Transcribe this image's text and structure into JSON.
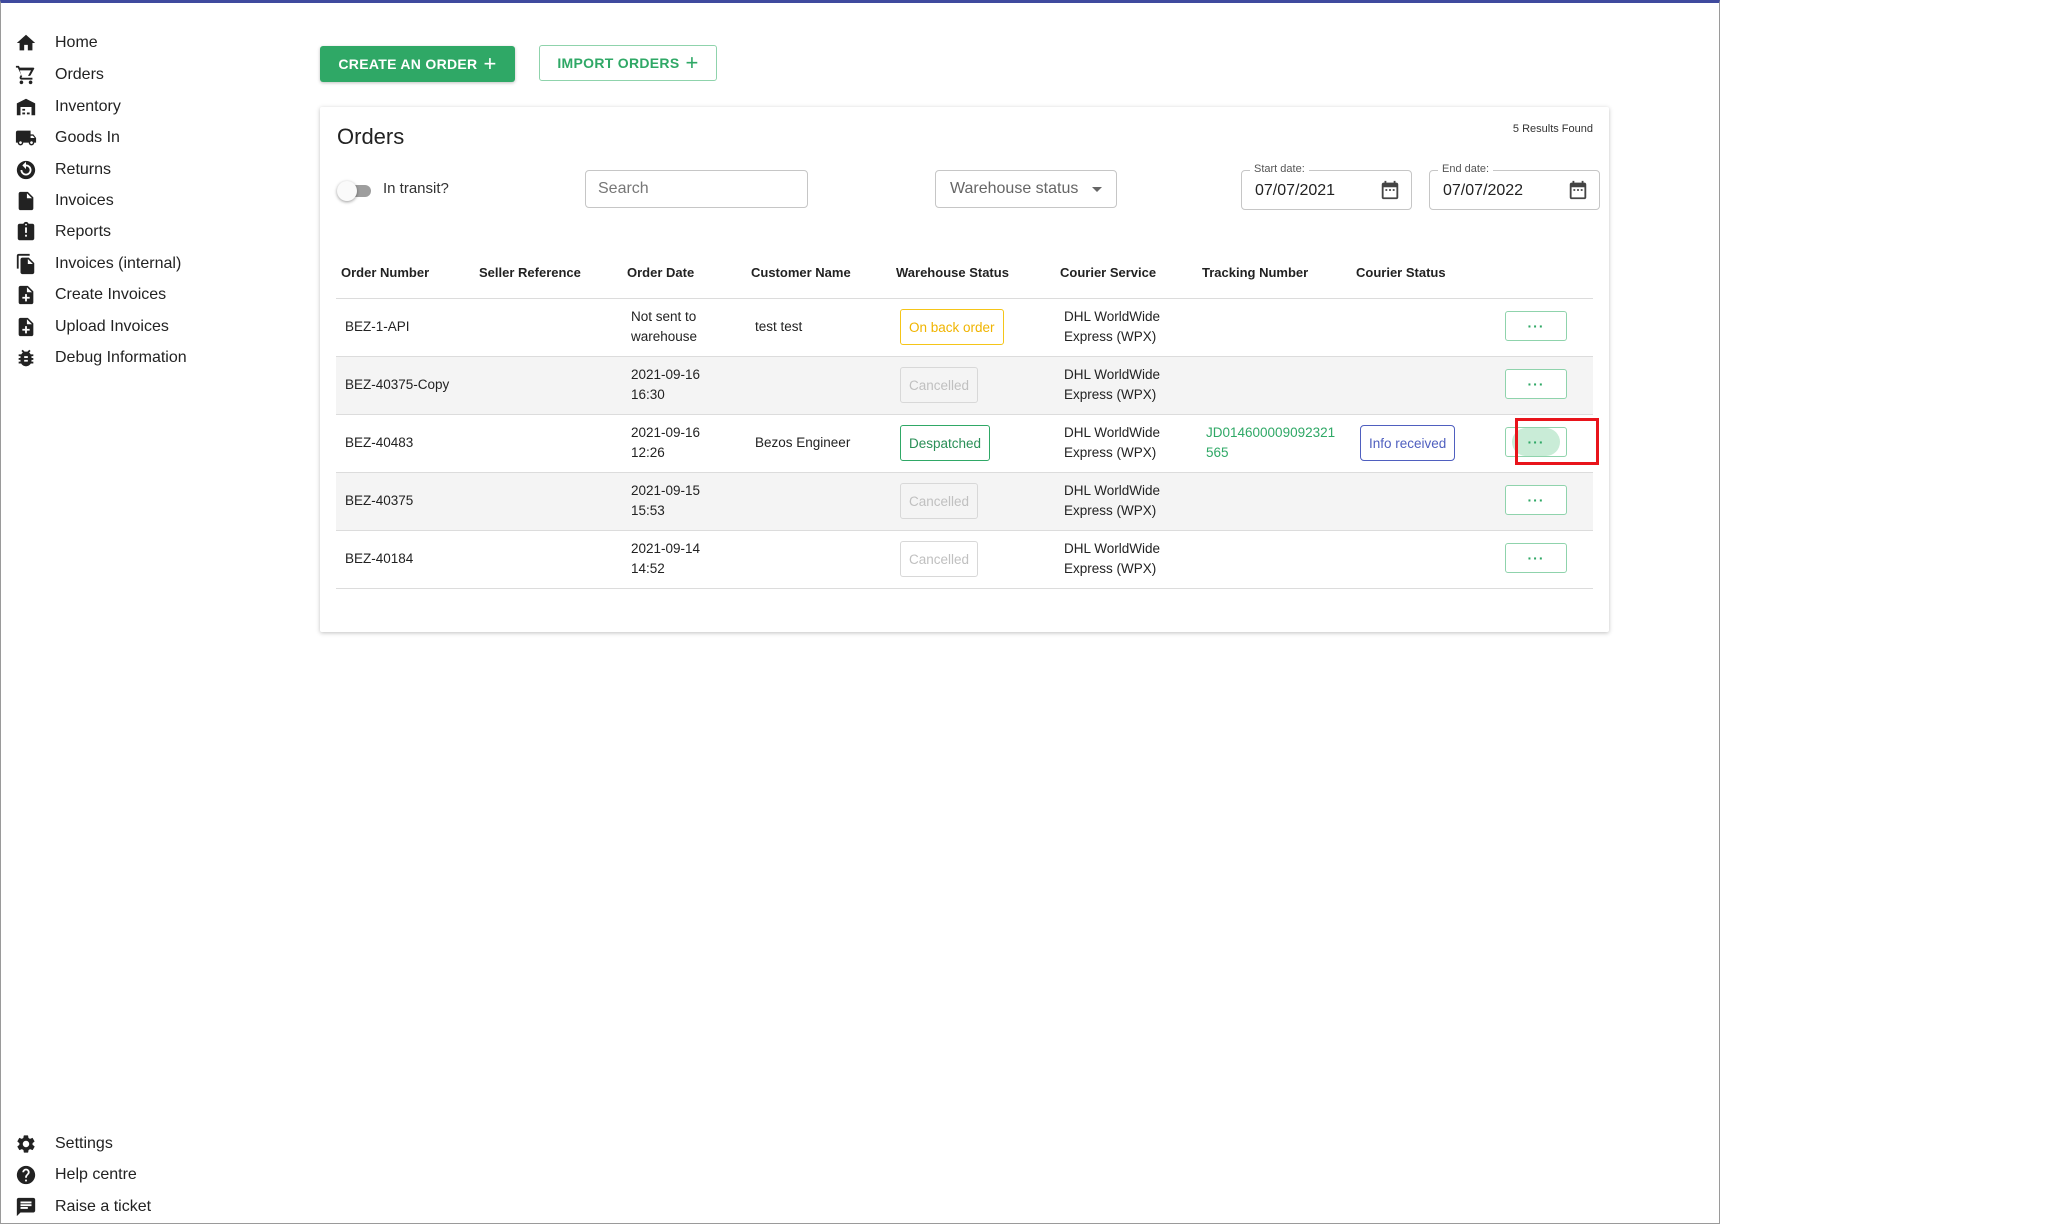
{
  "sidebar": {
    "top_items": [
      {
        "label": "Home",
        "icon": "home-icon"
      },
      {
        "label": "Orders",
        "icon": "cart-icon"
      },
      {
        "label": "Inventory",
        "icon": "warehouse-icon"
      },
      {
        "label": "Goods In",
        "icon": "truck-icon"
      },
      {
        "label": "Returns",
        "icon": "returns-icon"
      },
      {
        "label": "Invoices",
        "icon": "document-icon"
      },
      {
        "label": "Reports",
        "icon": "report-icon"
      },
      {
        "label": "Invoices (internal)",
        "icon": "copy-document-icon"
      },
      {
        "label": "Create Invoices",
        "icon": "add-document-icon"
      },
      {
        "label": "Upload Invoices",
        "icon": "upload-document-icon"
      },
      {
        "label": "Debug Information",
        "icon": "bug-icon"
      }
    ],
    "bottom_items": [
      {
        "label": "Settings",
        "icon": "gear-icon"
      },
      {
        "label": "Help centre",
        "icon": "help-icon"
      },
      {
        "label": "Raise a ticket",
        "icon": "chat-icon"
      }
    ]
  },
  "toolbar": {
    "create_label": "CREATE AN ORDER",
    "import_label": "IMPORT ORDERS",
    "plus": "+"
  },
  "orders": {
    "title": "Orders",
    "results": "5 Results Found",
    "toggle_label": "In transit?",
    "search_placeholder": "Search",
    "warehouse_status_placeholder": "Warehouse status",
    "start_date_label": "Start date:",
    "start_date": "07/07/2021",
    "end_date_label": "End date:",
    "end_date": "07/07/2022",
    "columns": [
      "Order Number",
      "Seller Reference",
      "Order Date",
      "Customer Name",
      "Warehouse Status",
      "Courier Service",
      "Tracking Number",
      "Courier Status"
    ],
    "actions_label": "···",
    "rows": [
      {
        "order": "BEZ-1-API",
        "seller_ref": "",
        "date1": "Not sent to",
        "date2": "warehouse",
        "customer": "test test",
        "status": "On back order",
        "status_type": "backorder",
        "courier1": "DHL WorldWide",
        "courier2": "Express (WPX)",
        "tracking1": "",
        "tracking2": "",
        "courier_status": ""
      },
      {
        "order": "BEZ-40375-Copy",
        "seller_ref": "",
        "date1": "2021-09-16",
        "date2": "16:30",
        "customer": "",
        "status": "Cancelled",
        "status_type": "cancelled",
        "courier1": "DHL WorldWide",
        "courier2": "Express (WPX)",
        "tracking1": "",
        "tracking2": "",
        "courier_status": ""
      },
      {
        "order": "BEZ-40483",
        "seller_ref": "",
        "date1": "2021-09-16",
        "date2": "12:26",
        "customer": "Bezos Engineer",
        "status": "Despatched",
        "status_type": "despatched",
        "courier1": "DHL WorldWide",
        "courier2": "Express (WPX)",
        "tracking1": "JD014600009092321",
        "tracking2": "565",
        "courier_status": "Info received"
      },
      {
        "order": "BEZ-40375",
        "seller_ref": "",
        "date1": "2021-09-15",
        "date2": "15:53",
        "customer": "",
        "status": "Cancelled",
        "status_type": "cancelled",
        "courier1": "DHL WorldWide",
        "courier2": "Express (WPX)",
        "tracking1": "",
        "tracking2": "",
        "courier_status": ""
      },
      {
        "order": "BEZ-40184",
        "seller_ref": "",
        "date1": "2021-09-14",
        "date2": "14:52",
        "customer": "",
        "status": "Cancelled",
        "status_type": "cancelled",
        "courier1": "DHL WorldWide",
        "courier2": "Express (WPX)",
        "tracking1": "",
        "tracking2": "",
        "courier_status": ""
      }
    ]
  },
  "colors": {
    "accent_green": "#2fa866",
    "window_top_border": "#3f4a9e",
    "highlight_red": "#e8141b",
    "backorder_yellow": "#f0b400",
    "info_purple": "#4f5fbf"
  }
}
